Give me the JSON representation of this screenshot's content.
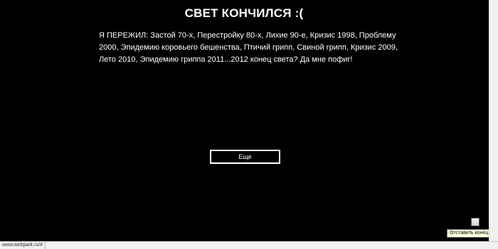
{
  "page": {
    "title": "СВЕТ КОНЧИЛСЯ :(",
    "body_text": "Я ПЕРЕЖИЛ: Застой 70-х, Перестройку 80-х, Лихие 90-е, Кризис 1998, Проблему 2000, Эпидемию коровьего бешенства, Птичий грипп, Свиной грипп, Кризис 2009, Лето 2010, Эпидемию гриппа 2011...2012 конец света? Да мне пофиг!",
    "more_button_label": "Еще"
  },
  "overlay": {
    "tooltip_text": "Отставить конец света"
  },
  "status_bar": {
    "url": "www.webpark.ru/#"
  },
  "colors": {
    "background": "#000000",
    "text": "#ffffff",
    "tooltip_background": "#ffffe1"
  },
  "icons": {
    "checkbox": "checkbox-icon"
  }
}
